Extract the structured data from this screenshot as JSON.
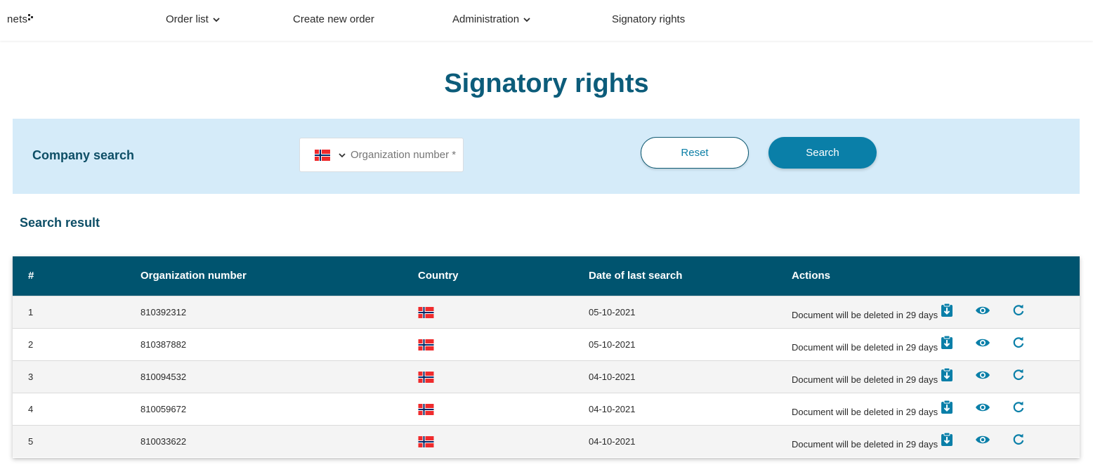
{
  "nav": {
    "logo_text": "nets",
    "items": [
      {
        "label": "Order list",
        "has_dropdown": true
      },
      {
        "label": "Create new order",
        "has_dropdown": false
      },
      {
        "label": "Administration",
        "has_dropdown": true
      },
      {
        "label": "Signatory rights",
        "has_dropdown": false
      }
    ]
  },
  "page": {
    "title": "Signatory rights"
  },
  "company_search": {
    "label": "Company search",
    "country_flag": "norway-flag",
    "org_placeholder": "Organization number *",
    "reset_label": "Reset",
    "search_label": "Search"
  },
  "results": {
    "label": "Search result",
    "columns": [
      "#",
      "Organization number",
      "Country",
      "Date of last search",
      "Actions"
    ],
    "rows": [
      {
        "num": "1",
        "org": "810392312",
        "country": "norway-flag",
        "date": "05-10-2021",
        "doc_text": "Document will be deleted in 29 days"
      },
      {
        "num": "2",
        "org": "810387882",
        "country": "norway-flag",
        "date": "05-10-2021",
        "doc_text": "Document will be deleted in 29 days"
      },
      {
        "num": "3",
        "org": "810094532",
        "country": "norway-flag",
        "date": "04-10-2021",
        "doc_text": "Document will be deleted in 29 days"
      },
      {
        "num": "4",
        "org": "810059672",
        "country": "norway-flag",
        "date": "04-10-2021",
        "doc_text": "Document will be deleted in 29 days"
      },
      {
        "num": "5",
        "org": "810033622",
        "country": "norway-flag",
        "date": "04-10-2021",
        "doc_text": "Document will be deleted in 29 days"
      }
    ]
  },
  "colors": {
    "primary": "#00546f",
    "accent": "#0a7fa8",
    "panel_bg": "#d5ebf9",
    "title": "#0c5c7a"
  }
}
